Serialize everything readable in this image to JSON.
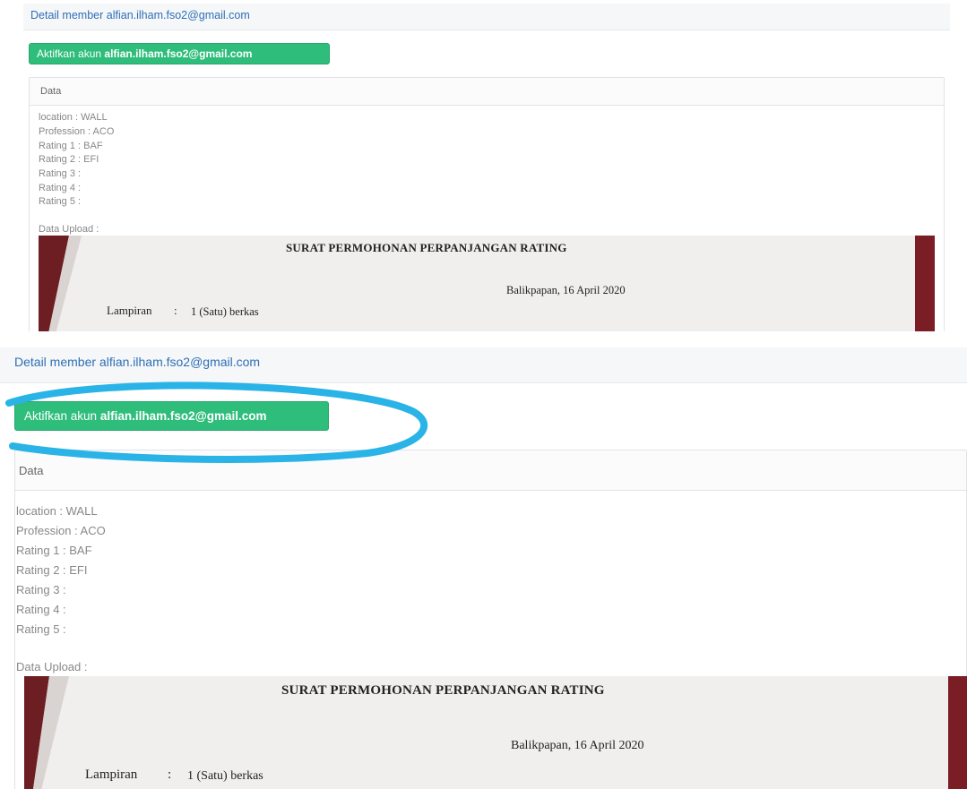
{
  "header": {
    "prefix": "Detail member",
    "email": "alfian.ilham.fso2@gmail.com"
  },
  "activate_button": {
    "prefix": "Aktifkan akun",
    "email": "alfian.ilham.fso2@gmail.com"
  },
  "data_card": {
    "heading": "Data",
    "fields": [
      "location : WALL",
      "Profession : ACO",
      "Rating 1 : BAF",
      "Rating 2 : EFI",
      "Rating 3 :",
      "Rating 4 :",
      "Rating 5 :"
    ],
    "upload_label": "Data Upload :"
  },
  "document": {
    "title": "SURAT PERMOHONAN PERPANJANGAN RATING",
    "place_date": "Balikpapan, 16 April 2020",
    "attachment_label": "Lampiran",
    "attachment_separator": ":",
    "attachment_value": "1 (Satu) berkas"
  },
  "colors": {
    "button_green": "#2ebd7b",
    "link_blue": "#2f6fb5",
    "highlight_cyan": "#29b3e6"
  }
}
